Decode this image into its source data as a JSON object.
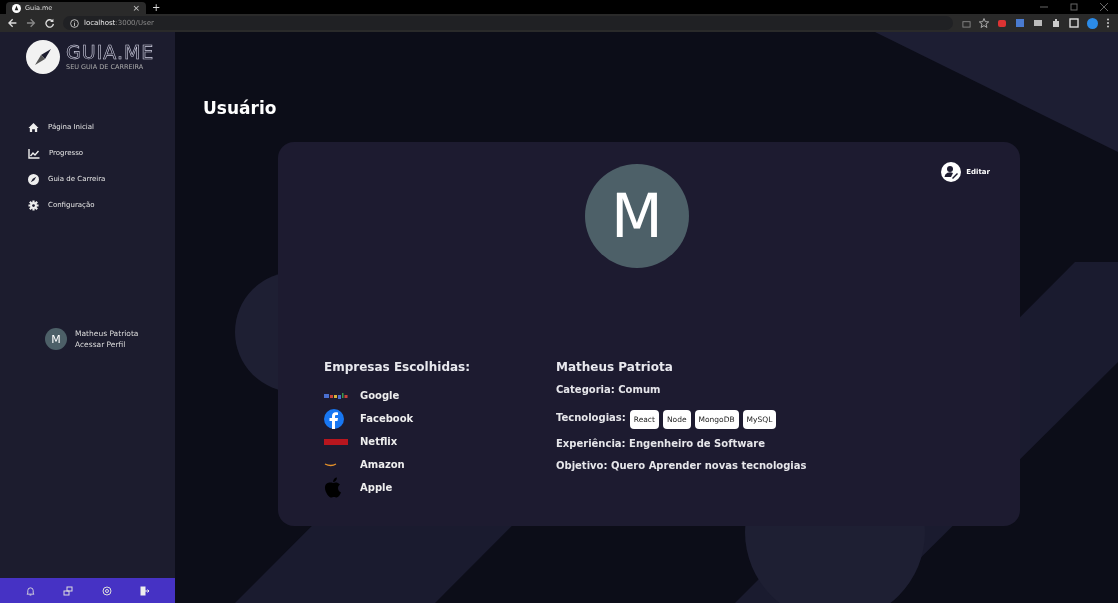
{
  "browser": {
    "tab_title": "Guia.me",
    "tab_close": "×",
    "new_tab": "+",
    "url_host": "localhost",
    "url_path": ":3000/User"
  },
  "sidebar": {
    "logo_title": "GUIA.ME",
    "logo_subtitle": "SEU GUIA DE CARREIRA",
    "items": [
      {
        "label": "Página Inicial",
        "kind": "home"
      },
      {
        "label": "Progresso",
        "kind": "chart"
      },
      {
        "label": "Guia de Carreira",
        "kind": "compass"
      },
      {
        "label": "Configuração",
        "kind": "gear"
      }
    ],
    "profile": {
      "initial": "M",
      "name": "Matheus Patriota",
      "link": "Acessar Perfil"
    },
    "bottom_bar": [
      {
        "kind": "bell"
      },
      {
        "kind": "screens"
      },
      {
        "kind": "settings"
      },
      {
        "kind": "logout"
      }
    ]
  },
  "page": {
    "title": "Usuário"
  },
  "card": {
    "edit_button": "Editar",
    "avatar_initial": "M",
    "companies_title": "Empresas Escolhidas:",
    "companies": [
      {
        "name": "Google",
        "kind": "google"
      },
      {
        "name": "Facebook",
        "kind": "facebook"
      },
      {
        "name": "Netflix",
        "kind": "netflix"
      },
      {
        "name": "Amazon",
        "kind": "amazon"
      },
      {
        "name": "Apple",
        "kind": "apple"
      }
    ],
    "user_name": "Matheus Patriota",
    "category": "Categoria: Comum",
    "technologies_label": "Tecnologias:",
    "technologies": [
      "React",
      "Node",
      "MongoDB",
      "MySQL"
    ],
    "experience": "Experiência: Engenheiro de Software",
    "goal": "Objetivo: Quero Aprender novas tecnologias"
  }
}
